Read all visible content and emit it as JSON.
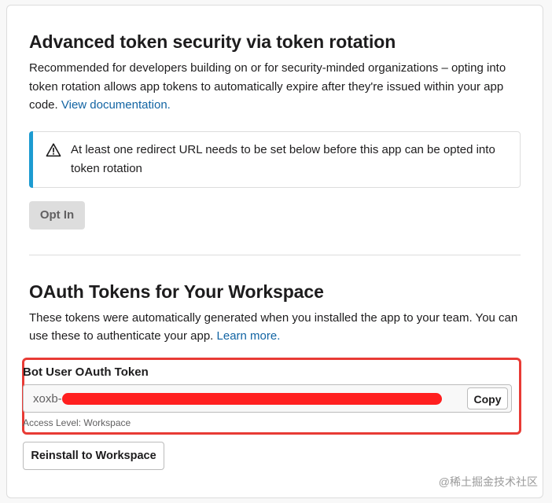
{
  "rotation": {
    "title": "Advanced token security via token rotation",
    "description": "Recommended for developers building on or for security-minded organizations – opting into token rotation allows app tokens to automatically expire after they're issued within your app code.",
    "doc_link": "View documentation.",
    "alert_icon": "warning-icon",
    "alert_text": "At least one redirect URL needs to be set below before this app can be opted into token rotation",
    "opt_in_label": "Opt In"
  },
  "oauth": {
    "title": "OAuth Tokens for Your Workspace",
    "description": "These tokens were automatically generated when you installed the app to your team. You can use these to authenticate your app.",
    "learn_more": "Learn more.",
    "bot_token_label": "Bot User OAuth Token",
    "bot_token_value": "xoxb-",
    "copy_label": "Copy",
    "access_level": "Access Level: Workspace",
    "reinstall_label": "Reinstall to Workspace"
  },
  "watermark": "@稀土掘金技术社区",
  "colors": {
    "link": "#1264a3",
    "alert_bar": "#1d9bd1",
    "highlight_border": "#e83b35",
    "redaction": "#ff1f1f"
  }
}
